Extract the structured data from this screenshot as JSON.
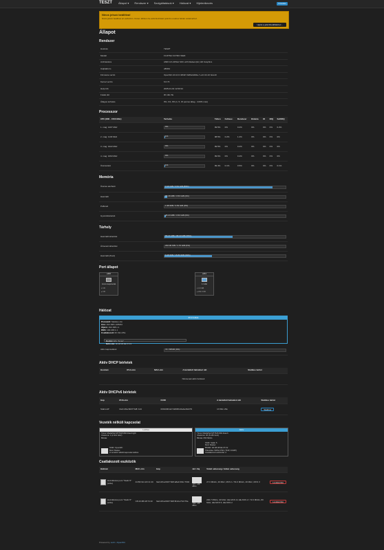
{
  "topbar": {
    "brand": "TESZT",
    "menu": [
      "Állapot ▾",
      "Rendszer ▾",
      "Szolgáltatások ▾",
      "Hálózat ▾",
      "Kijelentkezés"
    ],
    "indicator": "Frissítés"
  },
  "warning": {
    "title": "Nincs jelszó beállítva!",
    "text": "Nincs jelszó beállítva az eszközön. Kérem állítson be adminisztrátori jelszót a webes felület védelméhez.",
    "button": "Ugrás a jelszóbeállításhoz..."
  },
  "page_title": "Állapot",
  "system": {
    "heading": "Rendszer",
    "rows": [
      {
        "label": "Hostnév",
        "value": "TESZT"
      },
      {
        "label": "Modell",
        "value": "FUJITSU FUTRO S920"
      },
      {
        "label": "Architektúra",
        "value": "AMD GX-415GA SOC with Radeon(tm) HD Graphics"
      },
      {
        "label": "Célplatform",
        "value": "x86/64"
      },
      {
        "label": "Firmware verzió",
        "value": "OpenWrt 24.10.0 r28427-6df0e3d02a / LuCI 24.10 branch"
      },
      {
        "label": "Kernel verzió",
        "value": "6.6.73"
      },
      {
        "label": "Helyi idő",
        "value": "2025-01-01 12:00:34"
      },
      {
        "label": "Futási idő",
        "value": "0h 19m 8s"
      },
      {
        "label": "Átlagos terhelés",
        "value": "0%,   1%,   0%          (1, 5, 15 perces átlag - 4.00% max)"
      }
    ]
  },
  "processor": {
    "heading": "Processzor",
    "headers": [
      "CPU (800 - 1500 MHz)",
      "Terhelés",
      "Tétlen",
      "Felhasz.",
      "Rendszer",
      "Elvárás",
      "IO",
      "IRQ",
      "SoftIRQ"
    ],
    "rows": [
      {
        "name": "1. mag: 1207 MHz",
        "load": "0%",
        "fill": 0.0,
        "idle": "99.5%",
        "user": "0%",
        "sys": "0.2%",
        "nice": "0%",
        "io": "0%",
        "irq": "0%",
        "softirq": "0.2%"
      },
      {
        "name": "2. mag: 1133 MHz",
        "load": "1%",
        "fill": 0.01,
        "idle": "98.5%",
        "user": "0.2%",
        "sys": "1.2%",
        "nice": "0%",
        "io": "0%",
        "irq": "0%",
        "softirq": "0%"
      },
      {
        "name": "3. mag: 1022 MHz",
        "load": "0%",
        "fill": 0.0,
        "idle": "99.5%",
        "user": "0%",
        "sys": "0.2%",
        "nice": "0%",
        "io": "0%",
        "irq": "0%",
        "softirq": "0%"
      },
      {
        "name": "4. mag: 1063 MHz",
        "load": "0%",
        "fill": 0.0,
        "idle": "99.6%",
        "user": "0%",
        "sys": "0.4%",
        "nice": "0%",
        "io": "0%",
        "irq": "0%",
        "softirq": "0%"
      },
      {
        "name": "Összesített",
        "load": "1%",
        "fill": 0.01,
        "idle": "99.4%",
        "user": "0.1%",
        "sys": "0.5%",
        "nice": "0%",
        "io": "0%",
        "irq": "0%",
        "softirq": "0.1%"
      }
    ]
  },
  "memory": {
    "heading": "Memória",
    "rows": [
      {
        "label": "Összes elérhető",
        "value": "3.16 GiB / 3.53 GiB (89%)",
        "fill": 0.89
      },
      {
        "label": "Használt",
        "value": "85.46 MiB / 3.53 GiB (2%)",
        "fill": 0.02
      },
      {
        "label": "Pufferelt",
        "value": "1.98 MiB / 3.53 GiB (0%)",
        "fill": 0.0
      },
      {
        "label": "Gyorsítótárazott",
        "value": "28.24 MiB / 3.53 GiB (0%)",
        "fill": 0.01
      }
    ]
  },
  "storage": {
    "heading": "Tárhely",
    "rows": [
      {
        "label": "Használt tárterület",
        "value": "55.21 MiB / 98.33 MiB (56%)",
        "fill": 0.56
      },
      {
        "label": "Átmeneti tárterület",
        "value": "232.00 KiB / 1.76 GiB (0%)",
        "fill": 0.0
      },
      {
        "label": "Használt (/boot)",
        "value": "6.28 MiB / 15.83 MiB (39%)",
        "fill": 0.39
      }
    ]
  },
  "ports": {
    "heading": "Port állapot",
    "items": [
      {
        "name": "eth0",
        "speed": "nincs kapcsolat",
        "rx": "▾ 0 B",
        "tx": "▴ 0 B"
      },
      {
        "name": "eth1",
        "speed": "1 Gbit",
        "rx": "▾ 3.0 MB",
        "tx": "▴ 202.3 KB"
      }
    ]
  },
  "network": {
    "heading": "Hálózat",
    "box_title": "IPv4 felfelé",
    "lines": [
      {
        "k": "Protokoll:",
        "v": "Statikus cím"
      },
      {
        "k": "Cím:",
        "v": "192.168.1.205/24"
      },
      {
        "k": "Átjáró:",
        "v": "192.168.1.1"
      },
      {
        "k": "DNS:",
        "v": "192.168.1.1"
      },
      {
        "k": "Csatlakozott:",
        "v": "0h 19m 05s"
      }
    ],
    "sub": [
      {
        "k": "Eszköz:",
        "v": "Eth. \"br-lan\""
      },
      {
        "k": "MAC-cím:",
        "v": "00:1B:38:4E:37:F1"
      }
    ],
    "active_conn_label": "Aktív kapcsolatok",
    "active_conn_value": "72 / 65536 (0%)",
    "active_conn_fill": 0.0
  },
  "dhcp": {
    "heading": "Aktív DHCP bérletek",
    "headers": [
      "Hostnév",
      "IPv4-cím",
      "MAC-cím",
      "A bérletből hátralévő idő",
      "Statikus bérlet"
    ],
    "empty": "Nincsenek aktív bérletek"
  },
  "dhcp6": {
    "heading": "Aktív DHCPv6 bérletek",
    "headers": [
      "Gép",
      "IPv6-cím",
      "DUID",
      "A bérletből hátralévő idő",
      "Statikus bérlet"
    ],
    "rows": [
      {
        "host": "Stalin-HP",
        "ip": "fde3:df1a:8d37:5d8::124",
        "duid": "000100012c7a9f36bc0a4a4b2279",
        "time": "1h 59m 29s",
        "action": "Statikus"
      }
    ]
  },
  "wireless": {
    "heading": "Vezeték nélküli kapcsolat",
    "boxes": [
      {
        "status": "Letiltva",
        "lines": [
          "Típus: MediaTek MT7615 802.11ac/n/g/b",
          "Csatorna: 1 (2.412 GHz)",
          "Bitráta:"
        ],
        "sig": [
          "SSID: OpenWrt",
          "Mód: Master",
          "A vezeték nélküli kapcsolat letiltva"
        ]
      },
      {
        "status": "Aktív",
        "lines": [
          "Típus: MediaTek MT7615 802.11ac/n",
          "Csatorna: 36 (5.180 GHz)",
          "Bitráta: 650 Mbit/s"
        ],
        "sig": [
          "SSID: Stalin 5",
          "Mód: Master",
          "BSSID: 00:1B:38:4E:37:F2",
          "Titkosítás: WPA2 PSK (TKIP, CCMP)",
          "Csatlakozott eszközök: 2"
        ]
      }
    ]
  },
  "associated": {
    "heading": "Csatlakozott eszközök",
    "headers": [
      "Hálózat",
      "MAC-cím",
      "Gép",
      "Jel / Zaj",
      "Vételi sebesség / Adási sebesség",
      ""
    ],
    "rows": [
      {
        "net": "Hozzáférési pont \"Stalin 5\" (wl1a)",
        "mac": "44:8D:3A:A0:C1:4C",
        "host": "fde3:df1a:8d37:5d8:a8a4:6b3c:7604",
        "signal": "-47 / -96 dBm",
        "rate": "27.0 Mbit/s, 40 MHz, MCS 1 / 54.0 Mbit/s, 40 MHz, MCS 3",
        "action": "Leválasztás"
      },
      {
        "net": "Hozzáférési pont \"Stalin 5\" (wl1a)",
        "mac": "C8:43:4B:A8:74:1F",
        "host": "fde3:df1a:8d37:5d8:f04d:e7b4:7f4e",
        "signal": "-50 / -95 dBm",
        "rate": "200.7 Mbit/s, 40 MHz, HE-MCS 11 HE-NSS 2 / 72.0 Mbit/s, 80 MHz, HE-MCS 5, HE-NSS 2",
        "action": "Leválasztás"
      }
    ]
  },
  "footer": {
    "prefix": "Powered by ",
    "link": "LuCI • OpenWrt"
  }
}
